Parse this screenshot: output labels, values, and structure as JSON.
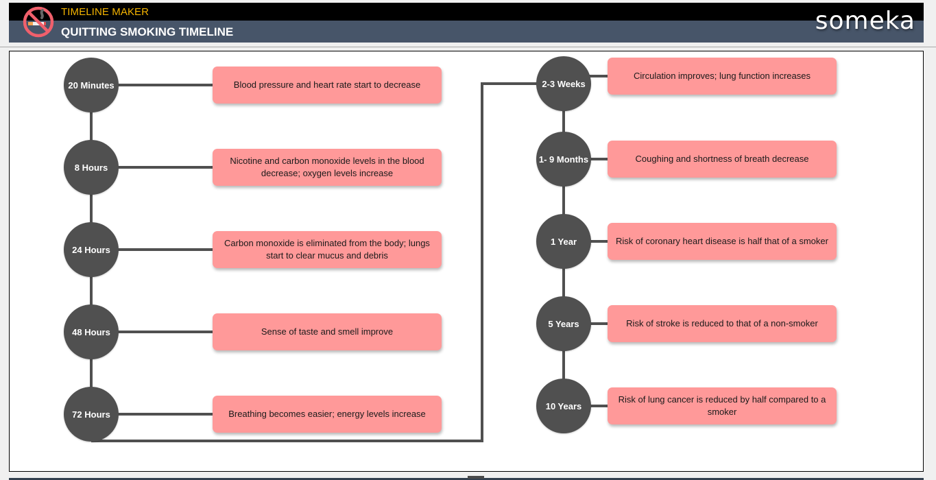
{
  "header": {
    "app_name": "TIMELINE MAKER",
    "page_title": "QUITTING SMOKING TIMELINE",
    "brand": "someka",
    "logo_icon": "no-smoking-icon"
  },
  "colors": {
    "header_top": "#000000",
    "header_bottom": "#475569",
    "app_name": "#f5b400",
    "node": "#505050",
    "event_box": "#ff9999",
    "connector": "#505050"
  },
  "timeline": {
    "left_column": [
      {
        "time": "20 Minutes",
        "event": "Blood pressure and heart rate start to decrease"
      },
      {
        "time": "8 Hours",
        "event": "Nicotine and carbon monoxide levels in the blood decrease; oxygen levels increase"
      },
      {
        "time": "24 Hours",
        "event": "Carbon monoxide is eliminated from the body; lungs start to clear mucus and debris"
      },
      {
        "time": "48 Hours",
        "event": "Sense of taste and smell improve"
      },
      {
        "time": "72 Hours",
        "event": "Breathing becomes easier; energy levels increase"
      }
    ],
    "right_column": [
      {
        "time": "2-3 Weeks",
        "event": "Circulation improves; lung function increases"
      },
      {
        "time": "1- 9 Months",
        "event": "Coughing and shortness of breath decrease"
      },
      {
        "time": "1 Year",
        "event": "Risk of coronary heart disease is half that of a smoker"
      },
      {
        "time": "5 Years",
        "event": "Risk of stroke is reduced to that of a non-smoker"
      },
      {
        "time": "10 Years",
        "event": "Risk of lung cancer is reduced by half compared to a smoker"
      }
    ]
  }
}
